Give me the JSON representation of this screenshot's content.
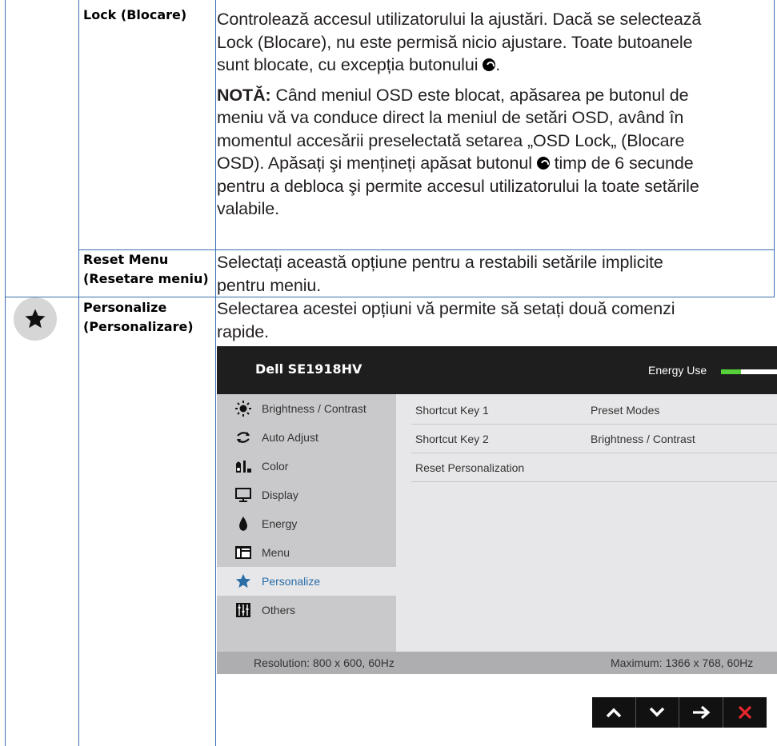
{
  "rows": {
    "lock": {
      "label": "Lock (Blocare)",
      "desc_1": "Controlează accesul utilizatorului la ajustări. Dacă se selectează",
      "desc_2": "Lock (Blocare), nu este permisă nicio ajustare. Toate butoanele",
      "desc_3": "sunt blocate, cu excepția butonului",
      "desc_3_end": ".",
      "note_bold": "NOTĂ:",
      "note_1": " Când meniul OSD este blocat, apăsarea pe butonul de",
      "note_2": "meniu vă va conduce direct la meniul de setări OSD, având în",
      "note_3": "momentul accesării preselectată setarea „OSD Lock„ (Blocare",
      "note_4a": "OSD). Apăsați şi mențineți apăsat butonul",
      "note_4b": " timp de 6 secunde",
      "note_5": "pentru a debloca şi permite accesul utilizatorului la toate setările",
      "note_6": "valabile."
    },
    "reset": {
      "label_1": "Reset Menu",
      "label_2": "(Resetare meniu)",
      "desc_1": "Selectați această opțiune pentru a restabili setările implicite",
      "desc_2": "pentru meniu."
    },
    "personalize": {
      "label_1": "Personalize",
      "label_2": "(Personalizare)",
      "desc_1": "Selectarea acestei opțiuni vă permite să setați două comenzi",
      "desc_2": "rapide."
    }
  },
  "osd": {
    "title": "Dell SE1918HV",
    "energy_label": "Energy Use",
    "energy_level": 0.35,
    "menu": [
      {
        "label": "Brightness / Contrast",
        "icon": "sun-icon"
      },
      {
        "label": "Auto Adjust",
        "icon": "auto-adjust-icon"
      },
      {
        "label": "Color",
        "icon": "color-icon"
      },
      {
        "label": "Display",
        "icon": "display-icon"
      },
      {
        "label": "Energy",
        "icon": "energy-icon"
      },
      {
        "label": "Menu",
        "icon": "menu-icon"
      },
      {
        "label": "Personalize",
        "icon": "star-icon"
      },
      {
        "label": "Others",
        "icon": "others-icon"
      }
    ],
    "shortcuts": [
      {
        "key": "Shortcut Key 1",
        "value": "Preset Modes"
      },
      {
        "key": "Shortcut Key 2",
        "value": "Brightness / Contrast"
      },
      {
        "key": "Reset Personalization",
        "value": ""
      }
    ],
    "resolution": "Resolution: 800 x 600, 60Hz",
    "maximum": "Maximum: 1366 x 768, 60Hz",
    "accent": "#2a6ea8",
    "energy_color": "#56d13a"
  },
  "buttons": [
    {
      "icon": "up-arrow-icon"
    },
    {
      "icon": "down-arrow-icon"
    },
    {
      "icon": "right-arrow-icon"
    },
    {
      "icon": "close-icon",
      "color": "#e8262c"
    }
  ]
}
